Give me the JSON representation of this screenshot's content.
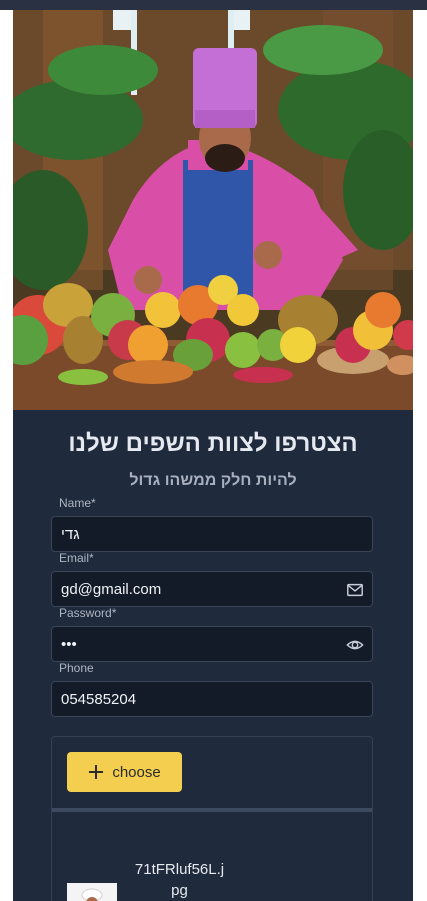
{
  "form": {
    "heading": "הצטרפו לצוות השפים שלנו",
    "subheading": "להיות חלק ממשהו גדול",
    "name_label": "Name*",
    "name_value": "גדי",
    "email_label": "Email*",
    "email_value": "gd@gmail.com",
    "password_label": "Password*",
    "password_value": "•••",
    "phone_label": "Phone",
    "phone_value": "054585204"
  },
  "upload": {
    "choose_label": "choose",
    "file_name": "71tFRluf56L.jpg"
  },
  "icons": {
    "email": "mail-icon",
    "password": "eye-icon",
    "choose": "plus-icon"
  },
  "colors": {
    "card_bg": "#1f2a3c",
    "input_bg": "#131b29",
    "accent": "#f4cf4f"
  }
}
